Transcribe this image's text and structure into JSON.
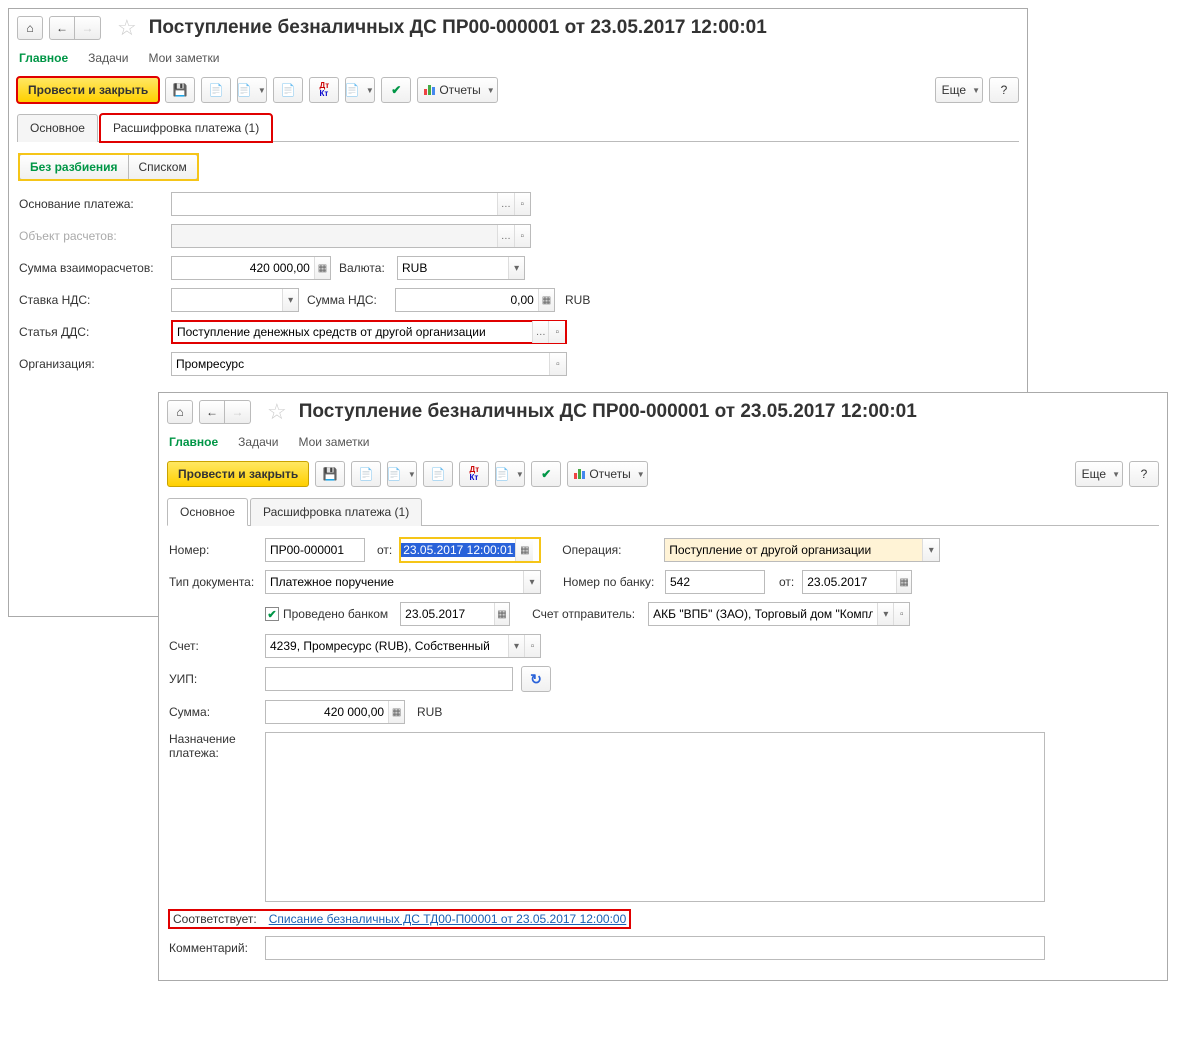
{
  "w1": {
    "title": "Поступление безналичных ДС ПР00-000001 от 23.05.2017 12:00:01",
    "nav": {
      "main": "Главное",
      "tasks": "Задачи",
      "notes": "Мои заметки"
    },
    "toolbar": {
      "post_close": "Провести и закрыть",
      "reports": "Отчеты",
      "more": "Еще",
      "help": "?"
    },
    "tabs": {
      "main": "Основное",
      "detail": "Расшифровка платежа (1)"
    },
    "seg": {
      "no_split": "Без разбиения",
      "list": "Списком"
    },
    "labels": {
      "payment_basis": "Основание платежа:",
      "calc_object": "Объект расчетов:",
      "settlement_sum": "Сумма взаиморасчетов:",
      "currency": "Валюта:",
      "vat_rate": "Ставка НДС:",
      "vat_sum": "Сумма НДС:",
      "dds": "Статья ДДС:",
      "org": "Организация:"
    },
    "values": {
      "settlement_sum": "420 000,00",
      "currency": "RUB",
      "vat_sum": "0,00",
      "currency_suffix": "RUB",
      "dds": "Поступление денежных средств от другой организации",
      "org": "Промресурс"
    }
  },
  "w2": {
    "title": "Поступление безналичных ДС ПР00-000001 от 23.05.2017 12:00:01",
    "nav": {
      "main": "Главное",
      "tasks": "Задачи",
      "notes": "Мои заметки"
    },
    "toolbar": {
      "post_close": "Провести и закрыть",
      "reports": "Отчеты",
      "more": "Еще",
      "help": "?"
    },
    "tabs": {
      "main": "Основное",
      "detail": "Расшифровка платежа (1)"
    },
    "labels": {
      "number": "Номер:",
      "from": "от:",
      "operation": "Операция:",
      "doc_type": "Тип документа:",
      "bank_number": "Номер по банку:",
      "bank_processed": "Проведено банком",
      "sender_account": "Счет отправитель:",
      "account": "Счет:",
      "uip": "УИП:",
      "sum": "Сумма:",
      "purpose": "Назначение платежа:",
      "corresponds": "Соответствует:",
      "comment": "Комментарий:"
    },
    "values": {
      "number": "ПР00-000001",
      "date": "23.05.2017 12:00:01",
      "operation": "Поступление от другой организации",
      "doc_type": "Платежное поручение",
      "bank_number": "542",
      "bank_date": "23.05.2017",
      "bank_processed_date": "23.05.2017",
      "sender_account": "АКБ \"ВПБ\" (ЗАО), Торговый дом \"Компл",
      "account": "4239, Промресурс (RUB), Собственный",
      "sum": "420 000,00",
      "currency": "RUB",
      "corresponds_link": "Списание безналичных ДС ТД00-П00001 от 23.05.2017 12:00:00"
    }
  }
}
